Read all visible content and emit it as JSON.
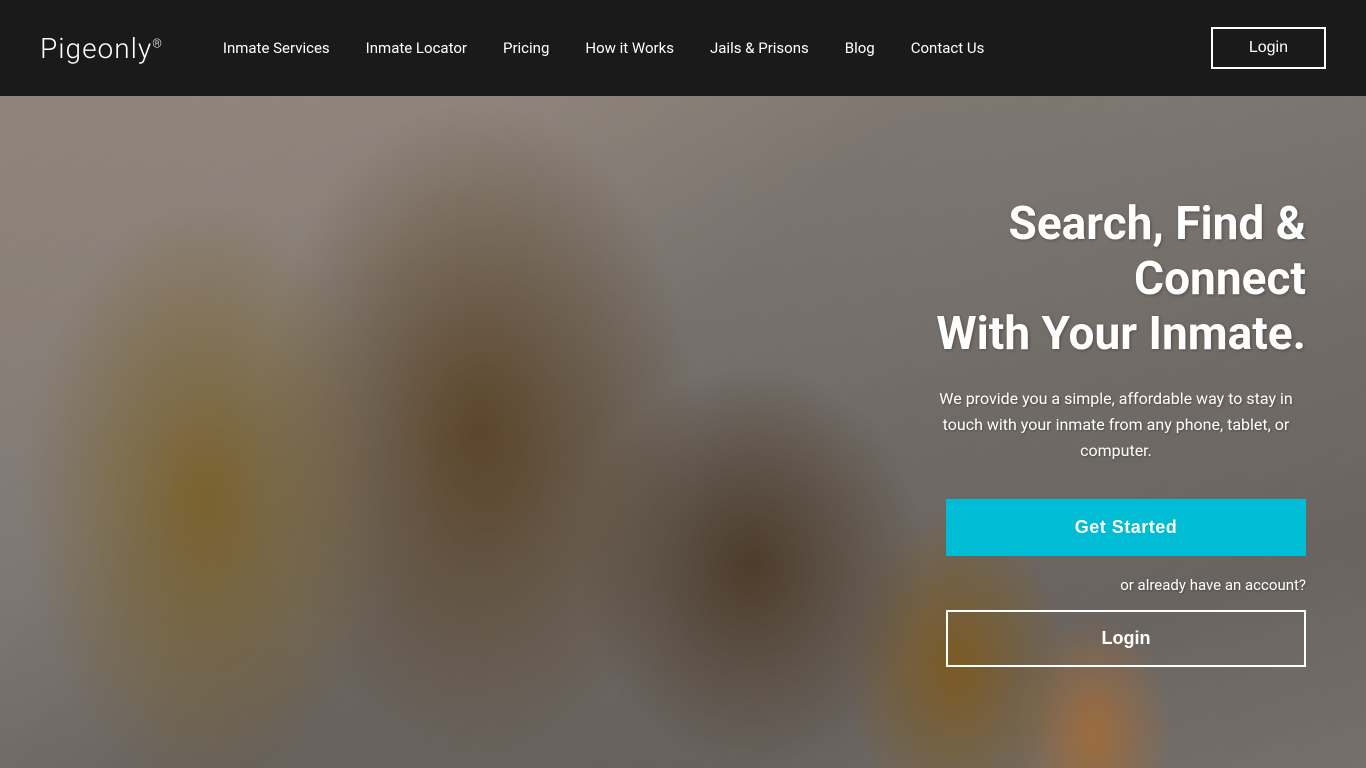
{
  "brand": {
    "logo_text": "Pigeonly",
    "logo_registered": "®"
  },
  "nav": {
    "links": [
      {
        "id": "inmate-services",
        "label": "Inmate Services"
      },
      {
        "id": "inmate-locator",
        "label": "Inmate Locator"
      },
      {
        "id": "pricing",
        "label": "Pricing"
      },
      {
        "id": "how-it-works",
        "label": "How it Works"
      },
      {
        "id": "jails-prisons",
        "label": "Jails & Prisons"
      },
      {
        "id": "blog",
        "label": "Blog"
      },
      {
        "id": "contact-us",
        "label": "Contact Us"
      }
    ],
    "login_label": "Login"
  },
  "hero": {
    "title_line1": "Search, Find &",
    "title_line2": "Connect",
    "title_line3": "With Your Inmate.",
    "subtitle": "We provide you a simple, affordable way to stay in touch with your inmate from any phone, tablet, or computer.",
    "cta_label": "Get Started",
    "already_account": "or already have an account?",
    "login_label": "Login"
  },
  "colors": {
    "nav_bg": "#1a1a1a",
    "cta_bg": "#00bcd4",
    "white": "#ffffff"
  }
}
